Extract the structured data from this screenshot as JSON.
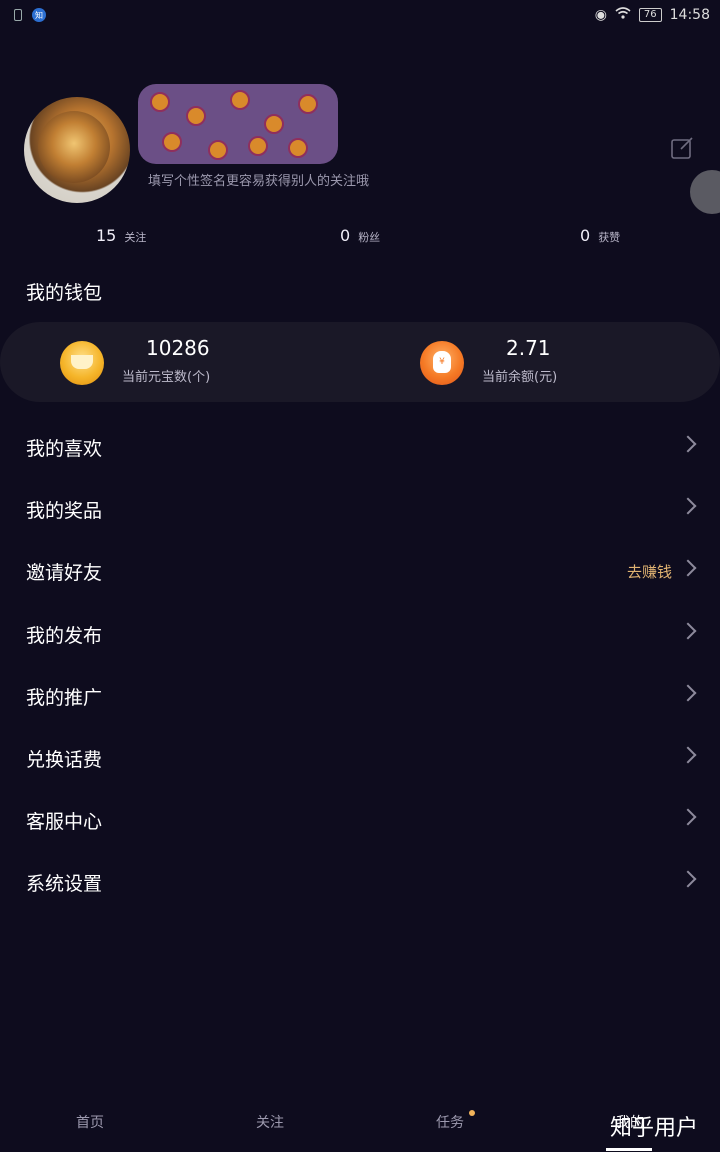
{
  "status_bar": {
    "time": "14:58",
    "battery": "76",
    "app_badge": "知"
  },
  "profile": {
    "bio": "填写个性签名更容易获得别人的关注哦"
  },
  "stats": [
    {
      "value": "15",
      "label": "关注"
    },
    {
      "value": "0",
      "label": "粉丝"
    },
    {
      "value": "0",
      "label": "获赞"
    }
  ],
  "wallet": {
    "title": "我的钱包",
    "ingots": {
      "value": "10286",
      "label": "当前元宝数(个)"
    },
    "balance": {
      "value": "2.71",
      "label": "当前余额(元)",
      "icon_mark": "¥"
    }
  },
  "menu": [
    {
      "label": "我的喜欢"
    },
    {
      "label": "我的奖品"
    },
    {
      "label": "邀请好友",
      "extra": "去赚钱"
    },
    {
      "label": "我的发布"
    },
    {
      "label": "我的推广"
    },
    {
      "label": "兑换话费"
    },
    {
      "label": "客服中心"
    },
    {
      "label": "系统设置"
    }
  ],
  "tabs": [
    {
      "label": "首页"
    },
    {
      "label": "关注"
    },
    {
      "label": "任务"
    },
    {
      "label": "我的"
    }
  ],
  "watermark": "知乎用户",
  "colors": {
    "background": "#0e0c1e",
    "accent": "#e0b372"
  }
}
